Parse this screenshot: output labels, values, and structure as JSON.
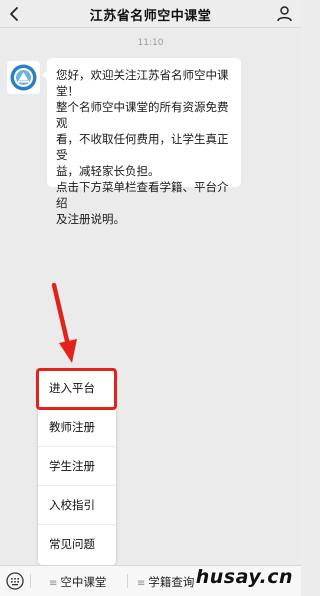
{
  "header": {
    "title": "江苏省名师空中课堂"
  },
  "chat": {
    "timestamp": "11:10",
    "message": "您好，欢迎关注江苏省名师空中课\n堂！\n整个名师空中课堂的所有资源免费观\n看，不收取任何费用，让学生真正受\n益，减轻家长负担。\n点击下方菜单栏查看学籍、平台介绍\n及注册说明。"
  },
  "menu": {
    "items": [
      {
        "label": "进入平台",
        "highlighted": true
      },
      {
        "label": "教师注册"
      },
      {
        "label": "学生注册"
      },
      {
        "label": "入校指引"
      },
      {
        "label": "常见问题"
      }
    ]
  },
  "bottom_bar": {
    "tabs": [
      {
        "label": "空中课堂"
      },
      {
        "label": "学籍查询"
      }
    ]
  },
  "watermark": "husay.cn",
  "colors": {
    "highlight": "#e2231a",
    "arrow": "#e2231a",
    "background": "#ebebeb"
  }
}
